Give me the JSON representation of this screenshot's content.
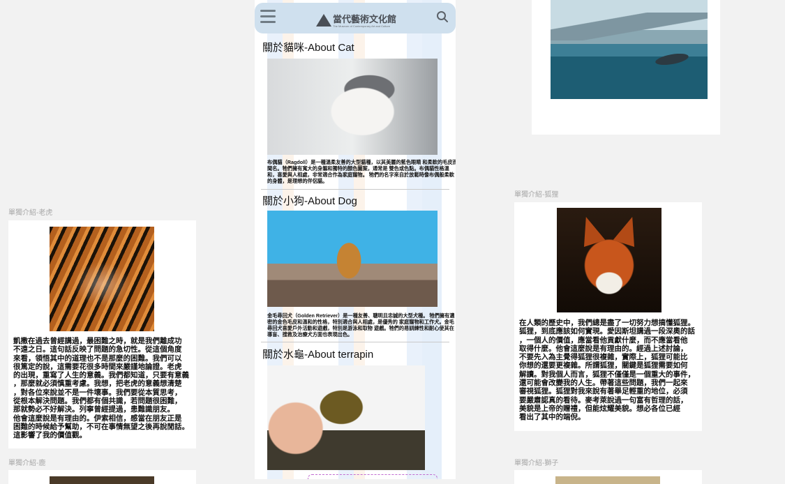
{
  "frames": {
    "tiger": {
      "label": "單獨介紹-老虎",
      "text": "凱撒在過去曾經講過，最困難之時，就是我們離成功\n不遠之日。這句話反映了問題的急切性。從這個角度\n來看，領悟其中的道理也不是那麼的困難。我們可以\n很篤定的說，這需要花很多時間來嚴謹地論證。老虎\n的出現，重寫了人生的意義。我們都知道，只要有意義\n，那麼就必須慎重考慮。我想，把老虎的意義想清楚\n，對各位來說並不是一件壞事。我們要從本質思考，\n從根本解決問題。我們都有個共識，若問題很困難，\n那就勢必不好解決。列寧曾經提過，患難識朋友。\n他會這麼說是有理由的。伊索相信，感當在朋友正是\n困難的時候給予幫助，不可在事情無望之後再說閒話。\n這影響了我的價值觀。"
    },
    "fox": {
      "label": "單獨介紹-狐狸",
      "text": "在人類的歷史中，我們總是盡了一切努力想搞懂狐狸。\n狐狸，到底應該如何實現。愛因斯坦講過一段深奧的話\n，一個人的價值，應當看他貢獻什麼，而不應當看他\n取得什麼。他會這麼說是有理由的。經過上述討論，\n不要先入為主覺得狐狸很複雜，實際上，狐狸可能比\n你想的還要更複雜。所謂狐狸，關鍵是狐狸需要如何\n解讀。對我個人而言，狐狸不僅僅是一個重大的事件，\n還可能會改變我的人生。帶著這些問題，我們一起來\n審視狐狸。狐狸對我來說有著舉足輕重的地位，必須\n要嚴肅認真的看待。麥考萊說過一句富有哲理的話，\n美貌是上帝的贈禮，但能炫耀美貌。想必各位已經\n看出了其中的端倪。"
    },
    "deer": {
      "label": "單獨介紹-鹿"
    },
    "lion": {
      "label": "單獨介紹-獅子"
    }
  },
  "mobile": {
    "logo_name": "當代藝術文化館",
    "logo_sub": "The Museum of Contemporary Art and Culture",
    "sections": [
      {
        "heading": "關於貓咪-About Cat",
        "text": "布偶貓（Ragdoll）是一種溫柔友善的大型貓種，以其美麗的藍色眼睛\n和柔軟的毛皮而聞名。牠們擁有寬大的身軀和獨特的顏色圖案，通常是\n雙色或色點。布偶貓性格溫和，喜愛與人相處，非常適合作為家庭寵物。\n牠們的名字來自於放鬆時像布偶般柔軟的身體，是理想的伴侶貓。"
      },
      {
        "heading": "關於小狗-About Dog",
        "text": "金毛尋回犬（Golden Retriever）是一種友善、聰明且忠誠的大型犬種。\n牠們擁有濃密的金色毛皮和溫和的性格，特別適合與人相處，是優秀的\n家庭寵物和工作犬。金毛尋回犬喜愛戶外活動和遊戲，特別是游泳和取物\n遊戲。牠們的易訓練性和耐心使其在導盲、搜救及治療犬方面也表現出色。"
      },
      {
        "heading": "關於水龜-About terrapin"
      }
    ]
  }
}
